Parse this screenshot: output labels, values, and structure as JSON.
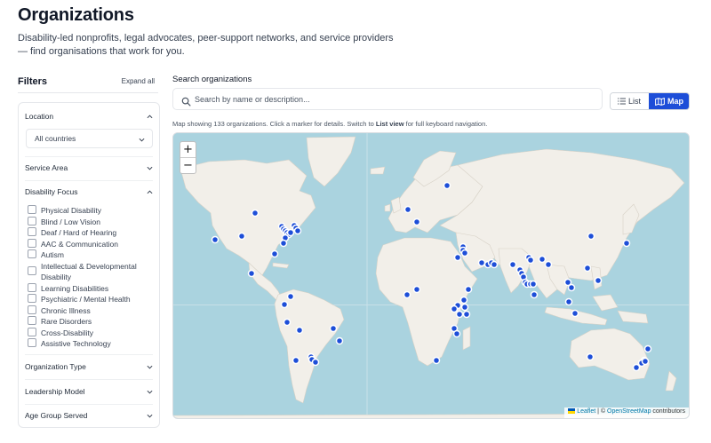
{
  "header": {
    "title": "Organizations",
    "subtitle": "Disability-led nonprofits, legal advocates, peer-support networks, and service providers — find organisations that work for you."
  },
  "filters": {
    "title": "Filters",
    "expand_all": "Expand all",
    "location": {
      "label": "Location",
      "selected": "All countries",
      "expanded": true
    },
    "service_area": {
      "label": "Service Area",
      "expanded": false
    },
    "disability_focus": {
      "label": "Disability Focus",
      "expanded": true,
      "options": [
        "Physical Disability",
        "Blind / Low Vision",
        "Deaf / Hard of Hearing",
        "AAC & Communication",
        "Autism",
        "Intellectual & Developmental Disability",
        "Learning Disabilities",
        "Psychiatric / Mental Health",
        "Chronic Illness",
        "Rare Disorders",
        "Cross-Disability",
        "Assistive Technology"
      ]
    },
    "organization_type": {
      "label": "Organization Type",
      "expanded": false
    },
    "leadership_model": {
      "label": "Leadership Model",
      "expanded": false
    },
    "age_group": {
      "label": "Age Group Served",
      "expanded": false
    }
  },
  "search": {
    "label": "Search organizations",
    "placeholder": "Search by name or description..."
  },
  "view_toggle": {
    "list_label": "List",
    "map_label": "Map",
    "active": "Map"
  },
  "map": {
    "caption_prefix": "Map showing 133 organizations. Click a marker for details. Switch to ",
    "caption_link": "List view",
    "caption_suffix": " for full keyboard navigation.",
    "zoom_in": "+",
    "zoom_out": "−",
    "attribution_leaflet": "Leaflet",
    "attribution_sep": " | © ",
    "attribution_osm": "OpenStreetMap",
    "attribution_suffix": " contributors",
    "colors": {
      "water": "#aad3df",
      "land": "#f2efe9",
      "marker": "#1d4ed8",
      "accent": "#1d4ed8"
    }
  }
}
